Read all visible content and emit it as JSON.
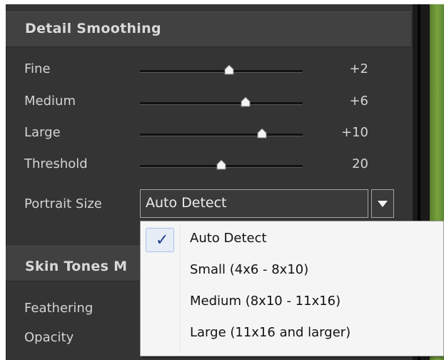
{
  "detail_smoothing": {
    "title": "Detail Smoothing",
    "sliders": [
      {
        "label": "Fine",
        "value": "+2",
        "level": 0.55
      },
      {
        "label": "Medium",
        "value": "+6",
        "level": 0.65
      },
      {
        "label": "Large",
        "value": "+10",
        "level": 0.75
      },
      {
        "label": "Threshold",
        "value": "20",
        "level": 0.5
      }
    ],
    "portrait_size": {
      "label": "Portrait Size",
      "selected": "Auto Detect"
    }
  },
  "portrait_size_menu": {
    "options": [
      {
        "label": "Auto Detect",
        "checked": true
      },
      {
        "label": "Small (4x6 - 8x10)",
        "checked": false
      },
      {
        "label": "Medium (8x10 - 11x16)",
        "checked": false
      },
      {
        "label": "Large (11x16 and larger)",
        "checked": false
      }
    ],
    "check_mark": "✓"
  },
  "skin_tones": {
    "title": "Skin Tones M",
    "feathering_label": "Feathering",
    "opacity_label": "Opacity"
  },
  "colors": {
    "panel": "#343434",
    "header": "#414141",
    "text": "#d4d4d4",
    "menu_bg": "#f5f5f5",
    "check": "#1f3c8c",
    "preview_green": "#7aa23e"
  }
}
